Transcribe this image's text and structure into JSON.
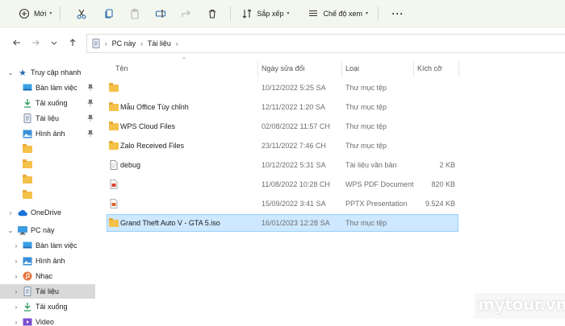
{
  "toolbar": {
    "new_label": "Mới",
    "sort_label": "Sắp xếp",
    "view_label": "Chế độ xem",
    "icons": [
      "plus-circle-icon",
      "cut-icon",
      "copy-icon",
      "paste-icon",
      "rename-icon",
      "share-icon",
      "delete-icon",
      "sort-icon",
      "view-icon",
      "more-icon"
    ]
  },
  "address": {
    "crumbs": [
      "PC này",
      "Tài liệu"
    ]
  },
  "sidebar": {
    "quick_access": "Truy cập nhanh",
    "items": [
      {
        "label": "Bàn làm việc",
        "icon": "desktop-icon",
        "pinned": true
      },
      {
        "label": "Tải xuống",
        "icon": "download-icon",
        "pinned": true
      },
      {
        "label": "Tài liệu",
        "icon": "document-icon",
        "pinned": true
      },
      {
        "label": "Hình ảnh",
        "icon": "pictures-icon",
        "pinned": true
      },
      {
        "label": "",
        "icon": "folder-icon"
      },
      {
        "label": "",
        "icon": "folder-icon"
      },
      {
        "label": "",
        "icon": "folder-icon"
      },
      {
        "label": "",
        "icon": "folder-icon"
      }
    ],
    "onedrive": "OneDrive",
    "this_pc": "PC này",
    "pc_items": [
      {
        "label": "Bàn làm việc",
        "icon": "desktop-icon"
      },
      {
        "label": "Hình ảnh",
        "icon": "pictures-icon"
      },
      {
        "label": "Nhạc",
        "icon": "music-icon"
      },
      {
        "label": "Tài liệu",
        "icon": "document-icon",
        "selected": true
      },
      {
        "label": "Tải xuống",
        "icon": "download-icon"
      },
      {
        "label": "Video",
        "icon": "video-icon"
      }
    ]
  },
  "columns": {
    "name": "Tên",
    "modified": "Ngày sửa đổi",
    "type": "Loại",
    "size": "Kích cỡ"
  },
  "files": [
    {
      "name": "",
      "modified": "10/12/2022 5:25 SA",
      "type": "Thư mục tệp",
      "size": "",
      "icon": "folder-icon"
    },
    {
      "name": "Mẫu Office Tùy chỉnh",
      "modified": "12/11/2022 1:20 SA",
      "type": "Thư mục tệp",
      "size": "",
      "icon": "folder-icon"
    },
    {
      "name": "WPS Cloud Files",
      "modified": "02/08/2022 11:57 CH",
      "type": "Thư mục tệp",
      "size": "",
      "icon": "folder-icon"
    },
    {
      "name": "Zalo Received Files",
      "modified": "23/11/2022 7:46 CH",
      "type": "Thư mục tệp",
      "size": "",
      "icon": "folder-icon"
    },
    {
      "name": "debug",
      "modified": "10/12/2022 5:31 SA",
      "type": "Tài liệu văn bản",
      "size": "2 KB",
      "icon": "text-file-icon"
    },
    {
      "name": "",
      "modified": "11/08/2022 10:28 CH",
      "type": "WPS PDF Document",
      "size": "820 KB",
      "icon": "pdf-file-icon"
    },
    {
      "name": "",
      "modified": "15/09/2022 3:41 SA",
      "type": "PPTX Presentation",
      "size": "9.524 KB",
      "icon": "pptx-file-icon"
    },
    {
      "name": "Grand Theft Auto V - GTA 5.iso",
      "modified": "16/01/2023 12:28 SA",
      "type": "Thư mục tệp",
      "size": "",
      "icon": "folder-icon",
      "selected": true
    }
  ],
  "watermark": "mytour.vn",
  "colors": {
    "toolbar_bg": "#f3f7ee",
    "folder": "#f4c14a",
    "selected_row": "#cde8ff",
    "selected_border": "#99d1ff",
    "sidebar_selected": "#d9d9d9"
  }
}
